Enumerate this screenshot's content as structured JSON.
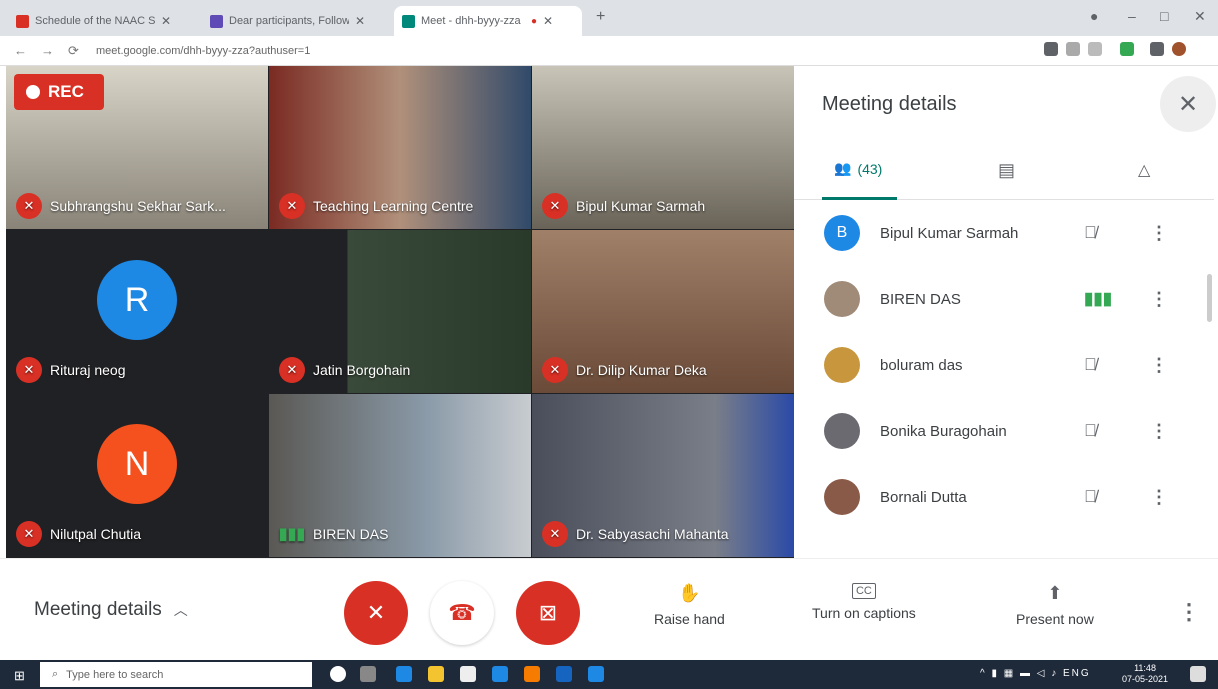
{
  "browser": {
    "tabs": [
      {
        "title": "Schedule of the NAAC Seminar -",
        "favicon_color": "#d93025"
      },
      {
        "title": "Dear participants, Following is c",
        "favicon_color": "#5f4bb6"
      },
      {
        "title": "Meet - dhh-byyy-zza",
        "favicon_color": "#00897b"
      }
    ],
    "url": "meet.google.com/dhh-byyy-zza?authuser=1"
  },
  "recording": {
    "label": "REC"
  },
  "tiles": [
    {
      "name": "Subhrangshu Sekhar Sark...",
      "mic": "off",
      "bg": "#8a8478"
    },
    {
      "name": "Teaching Learning Centre",
      "mic": "off",
      "bg": "#5a3a30"
    },
    {
      "name": "Bipul Kumar Sarmah",
      "mic": "off",
      "bg": "#9a9688"
    },
    {
      "name": "Rituraj neog",
      "mic": "off",
      "bg": "#202124",
      "initial": "R",
      "avatar_color": "#1e88e5"
    },
    {
      "name": "Jatin Borgohain",
      "mic": "off",
      "bg": "#3a3a34"
    },
    {
      "name": "Dr. Dilip Kumar Deka",
      "mic": "off",
      "bg": "#7a5a48"
    },
    {
      "name": "Nilutpal Chutia",
      "mic": "off",
      "bg": "#202124",
      "initial": "N",
      "avatar_color": "#f4511e"
    },
    {
      "name": "BIREN DAS",
      "mic": "speaking",
      "bg": "#4a4844"
    },
    {
      "name": "Dr. Sabyasachi Mahanta",
      "mic": "off",
      "bg": "#5a5e6a"
    }
  ],
  "panel": {
    "title": "Meeting details",
    "people_count": "(43)",
    "participants": [
      {
        "name": "Bipul Kumar Sarmah",
        "initial": "B",
        "color": "#1e88e5",
        "mic": "off"
      },
      {
        "name": "BIREN DAS",
        "initial": "",
        "color": "#a08a78",
        "mic": "speaking"
      },
      {
        "name": "boluram das",
        "initial": "",
        "color": "#c8963c",
        "mic": "off"
      },
      {
        "name": "Bonika Buragohain",
        "initial": "",
        "color": "#6a6a70",
        "mic": "off"
      },
      {
        "name": "Bornali Dutta",
        "initial": "",
        "color": "#8a5a48",
        "mic": "off"
      }
    ]
  },
  "controls": {
    "meeting_details": "Meeting details",
    "raise_hand": "Raise hand",
    "captions": "Turn on captions",
    "present": "Present now"
  },
  "taskbar": {
    "search_placeholder": "Type here to search",
    "time": "11:48",
    "date": "07-05-2021",
    "lang": "ENG"
  }
}
